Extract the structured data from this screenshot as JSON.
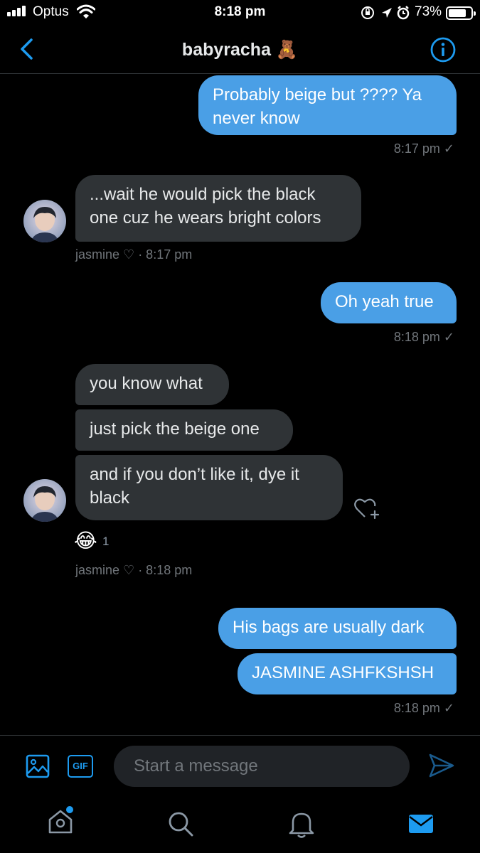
{
  "status_bar": {
    "carrier": "Optus",
    "time": "8:18 pm",
    "battery": "73%"
  },
  "header": {
    "title": "babyracha 🧸"
  },
  "messages": [
    {
      "direction": "out",
      "text": "Probably beige but ???? Ya never know",
      "time": "8:17 pm ✓"
    },
    {
      "direction": "in",
      "text": "...wait he would pick the black one cuz he wears bright colors",
      "sender": "jasmine ♡",
      "time": "· 8:17 pm"
    },
    {
      "direction": "out",
      "text": "Oh yeah true",
      "time": "8:18 pm ✓"
    },
    {
      "direction": "in",
      "text": "you know what"
    },
    {
      "direction": "in",
      "text": "just pick the beige one"
    },
    {
      "direction": "in",
      "text": "and if you don’t like it, dye it black",
      "reaction": "😂",
      "reaction_count": "1",
      "sender": "jasmine ♡",
      "time": "· 8:18 pm"
    },
    {
      "direction": "out",
      "text": "His bags are usually dark"
    },
    {
      "direction": "out",
      "text": "JASMINE ASHFKSHSH",
      "time": "8:18 pm ✓"
    }
  ],
  "composer": {
    "placeholder": "Start a message",
    "gif_label": "GIF"
  },
  "colors": {
    "accent": "#1d9bf0",
    "outgoing_bubble": "#4a9fe6",
    "incoming_bubble": "#2f3336",
    "background": "#000000"
  },
  "icons": {
    "status": [
      "signal-icon",
      "wifi-icon",
      "orientation-lock-icon",
      "location-icon",
      "alarm-icon",
      "battery-icon"
    ],
    "header": [
      "back-chevron-icon",
      "info-icon"
    ],
    "composer": [
      "image-icon",
      "gif-icon",
      "send-icon"
    ],
    "tabs": [
      "home-icon",
      "search-icon",
      "notifications-bell-icon",
      "messages-mail-icon"
    ]
  }
}
